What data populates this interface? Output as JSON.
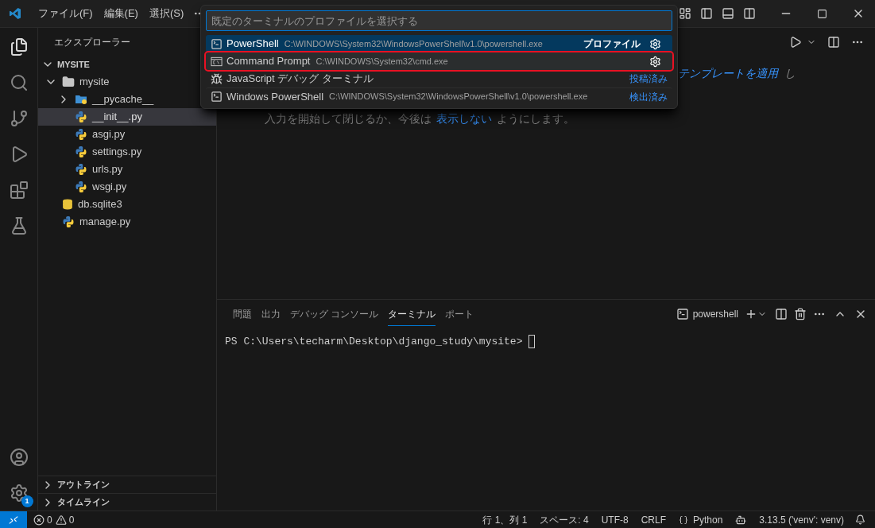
{
  "menu": [
    "ファイル(F)",
    "編集(E)",
    "選択(S)"
  ],
  "quick_pick": {
    "placeholder": "既定のターミナルのプロファイルを選択する",
    "items": [
      {
        "kind": "powershell",
        "label": "PowerShell",
        "detail": "C:\\WINDOWS\\System32\\WindowsPowerShell\\v1.0\\powershell.exe",
        "badge": "プロファイル",
        "settings_button": true,
        "selected": true,
        "highlighted": false
      },
      {
        "kind": "cmd",
        "label": "Command Prompt",
        "detail": "C:\\WINDOWS\\System32\\cmd.exe",
        "settings_button": true,
        "selected": false,
        "highlighted": true
      },
      {
        "kind": "debug",
        "label": "JavaScript デバッグ ターミナル",
        "badge": "投稿済み",
        "settings_button": false,
        "selected": false,
        "highlighted": false
      },
      {
        "kind": "powershell",
        "label": "Windows PowerShell",
        "detail": "C:\\WINDOWS\\System32\\WindowsPowerShell\\v1.0\\powershell.exe",
        "badge": "検出済み",
        "settings_button": false,
        "selected": false,
        "highlighted": false
      }
    ]
  },
  "sidebar": {
    "title": "エクスプローラー",
    "root": "MYSITE",
    "tree": [
      {
        "kind": "folder",
        "name": "mysite",
        "expanded": true,
        "selected": false,
        "children": [
          {
            "kind": "python_folder",
            "name": "__pycache__",
            "expanded": false,
            "selected": false
          },
          {
            "kind": "python",
            "name": "__init__.py",
            "selected": true
          },
          {
            "kind": "python",
            "name": "asgi.py",
            "selected": false
          },
          {
            "kind": "python",
            "name": "settings.py",
            "selected": false
          },
          {
            "kind": "python",
            "name": "urls.py",
            "selected": false
          },
          {
            "kind": "python",
            "name": "wsgi.py",
            "selected": false
          }
        ]
      },
      {
        "kind": "database",
        "name": "db.sqlite3",
        "selected": false
      },
      {
        "kind": "python",
        "name": "manage.py",
        "selected": false
      }
    ],
    "sections": [
      "アウトライン",
      "タイムライン"
    ]
  },
  "editor": {
    "hint_link": "テンプレートを適用",
    "hint_tail": "し",
    "line2_start": "入力を開始して閉じるか、今後は",
    "line2_link": "表示しない",
    "line2_end": "ようにします。"
  },
  "panel": {
    "tabs": [
      {
        "label": "問題",
        "selected": false
      },
      {
        "label": "出力",
        "selected": false
      },
      {
        "label": "デバッグ コンソール",
        "selected": false
      },
      {
        "label": "ターミナル",
        "selected": true
      },
      {
        "label": "ポート",
        "selected": false
      }
    ],
    "terminal_name": "powershell",
    "prompt": "PS C:\\Users\\techarm\\Desktop\\django_study\\mysite>"
  },
  "settings_badge": "1",
  "status_bar": {
    "errors": "0",
    "warnings": "0",
    "right": [
      "行 1、列 1",
      "スペース: 4",
      "UTF-8",
      "CRLF"
    ],
    "language": "Python",
    "interpreter": "3.13.5 ('venv': venv)"
  }
}
